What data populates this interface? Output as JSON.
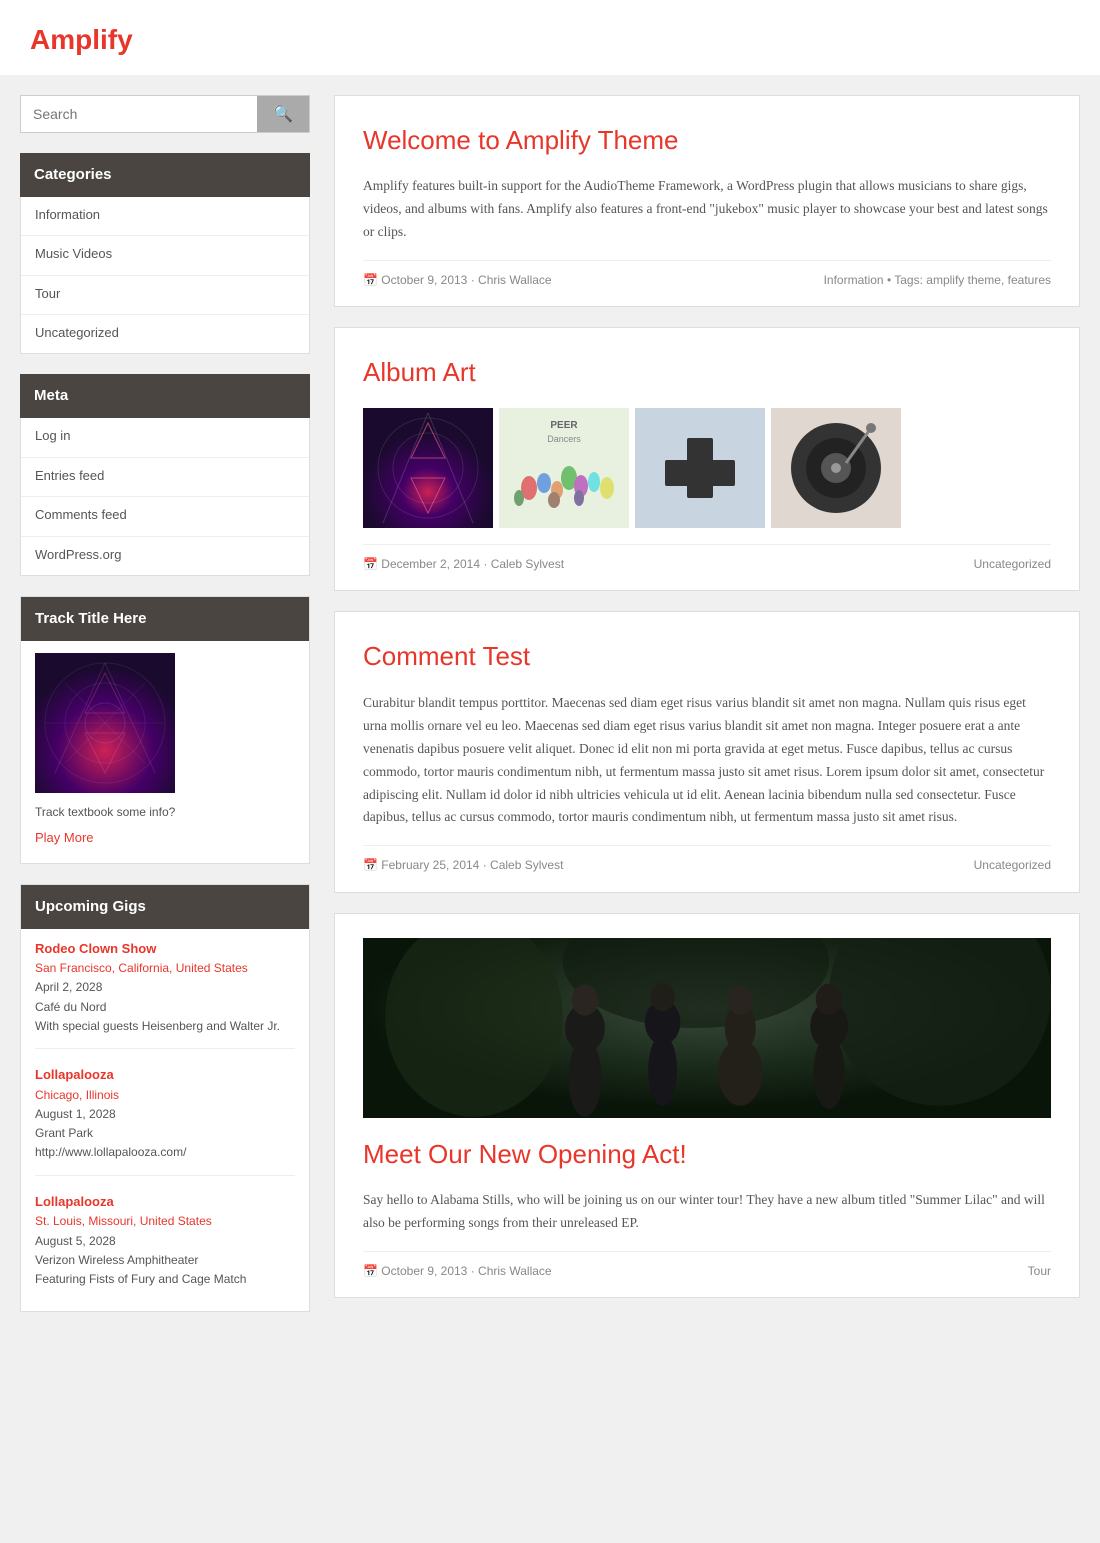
{
  "site": {
    "title": "Amplify"
  },
  "search": {
    "placeholder": "Search",
    "button_icon": "🔍"
  },
  "sidebar": {
    "categories_heading": "Categories",
    "categories": [
      {
        "label": "Information",
        "href": "#"
      },
      {
        "label": "Music Videos",
        "href": "#"
      },
      {
        "label": "Tour",
        "href": "#"
      },
      {
        "label": "Uncategorized",
        "href": "#"
      }
    ],
    "meta_heading": "Meta",
    "meta_links": [
      {
        "label": "Log in",
        "href": "#"
      },
      {
        "label": "Entries feed",
        "href": "#"
      },
      {
        "label": "Comments feed",
        "href": "#"
      },
      {
        "label": "WordPress.org",
        "href": "#"
      }
    ],
    "track_heading": "Track Title Here",
    "track_info": "Track textbook some info?",
    "play_more": "Play More",
    "gigs_heading": "Upcoming Gigs",
    "gigs": [
      {
        "name": "Rodeo Clown Show",
        "location": "San Francisco, California, United States",
        "date": "April 2, 2028",
        "venue": "Café du Nord",
        "guests": "With special guests Heisenberg and Walter Jr."
      },
      {
        "name": "Lollapalooza",
        "location": "Chicago, Illinois",
        "date": "August 1, 2028",
        "venue": "Grant Park",
        "guests": "http://www.lollapalooza.com/"
      },
      {
        "name": "Lollapalooza",
        "location": "St. Louis, Missouri, United States",
        "date": "August 5, 2028",
        "venue": "Verizon Wireless Amphitheater",
        "guests": "Featuring Fists of Fury and Cage Match"
      }
    ]
  },
  "posts": [
    {
      "id": "welcome",
      "title": "Welcome to Amplify Theme",
      "body": "Amplify features built-in support for the AudioTheme Framework, a WordPress plugin that allows musicians to share gigs, videos, and albums with fans. Amplify also features a front-end \"jukebox\" music player to showcase your best and latest songs or clips.",
      "date": "October 9, 2013",
      "author": "Chris Wallace",
      "tags": "Information • Tags: amplify theme, features"
    },
    {
      "id": "album-art",
      "title": "Album Art",
      "date": "December 2, 2014",
      "author": "Caleb Sylvest",
      "tags": "Uncategorized"
    },
    {
      "id": "comment-test",
      "title": "Comment Test",
      "body": "Curabitur blandit tempus porttitor. Maecenas sed diam eget risus varius blandit sit amet non magna. Nullam quis risus eget urna mollis ornare vel eu leo. Maecenas sed diam eget risus varius blandit sit amet non magna. Integer posuere erat a ante venenatis dapibus posuere velit aliquet. Donec id elit non mi porta gravida at eget metus. Fusce dapibus, tellus ac cursus commodo, tortor mauris condimentum nibh, ut fermentum massa justo sit amet risus. Lorem ipsum dolor sit amet, consectetur adipiscing elit. Nullam id dolor id nibh ultricies vehicula ut id elit. Aenean lacinia bibendum nulla sed consectetur. Fusce dapibus, tellus ac cursus commodo, tortor mauris condimentum nibh, ut fermentum massa justo sit amet risus.",
      "date": "February 25, 2014",
      "author": "Caleb Sylvest",
      "tags": "Uncategorized"
    },
    {
      "id": "opening-act",
      "title": "Meet Our New Opening Act!",
      "body": "Say hello to Alabama Stills, who will be joining us on our winter tour! They have a new album titled \"Summer Lilac\" and will also be performing songs from their unreleased EP.",
      "date": "October 9, 2013",
      "author": "Chris Wallace",
      "tags": "Tour"
    }
  ]
}
